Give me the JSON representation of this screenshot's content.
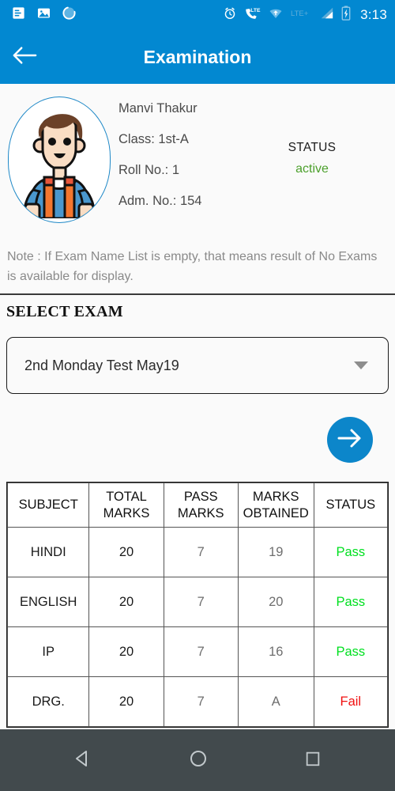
{
  "statusbar": {
    "icons_left": [
      "document-icon",
      "image-icon",
      "sync-circle-icon"
    ],
    "icons_right": [
      "alarm-icon",
      "lte-call-icon",
      "wifi-icon",
      "lte-plus-label",
      "signal-icon",
      "battery-charging-icon"
    ],
    "lte_plus_label": "LTE+",
    "lte_label": "LTE",
    "time": "3:13"
  },
  "appbar": {
    "back_icon": "arrow-left-icon",
    "title": "Examination",
    "color": "#0288d1"
  },
  "student": {
    "avatar_icon": "student-avatar-icon",
    "name": "Manvi  Thakur",
    "class": "Class: 1st-A",
    "roll_no": "Roll No.: 1",
    "adm_no": "Adm. No.: 154",
    "status_label": "STATUS",
    "status_value": "active",
    "status_color": "#4ca02c"
  },
  "note": "Note : If Exam Name List is empty, that means result of No Exams is available for display.",
  "select_exam": {
    "heading": "SELECT EXAM",
    "selected": "2nd Monday Test May19",
    "caret_icon": "chevron-down-icon"
  },
  "submit": {
    "icon": "arrow-right-icon",
    "color": "#0c86ca"
  },
  "results_table": {
    "columns": [
      "SUBJECT",
      "TOTAL MARKS",
      "PASS MARKS",
      "MARKS OBTAINED",
      "STATUS"
    ],
    "rows": [
      {
        "subject": "HINDI",
        "total_marks": "20",
        "pass_marks": "7",
        "marks_obtained": "19",
        "status": "Pass",
        "status_color": "#00e020"
      },
      {
        "subject": "ENGLISH",
        "total_marks": "20",
        "pass_marks": "7",
        "marks_obtained": "20",
        "status": "Pass",
        "status_color": "#00e020"
      },
      {
        "subject": "IP",
        "total_marks": "20",
        "pass_marks": "7",
        "marks_obtained": "16",
        "status": "Pass",
        "status_color": "#00e020"
      },
      {
        "subject": "DRG.",
        "total_marks": "20",
        "pass_marks": "7",
        "marks_obtained": "A",
        "status": "Fail",
        "status_color": "#f01010"
      }
    ]
  },
  "navbar": {
    "back_icon": "triangle-back-icon",
    "home_icon": "circle-home-icon",
    "recents_icon": "square-recents-icon"
  }
}
